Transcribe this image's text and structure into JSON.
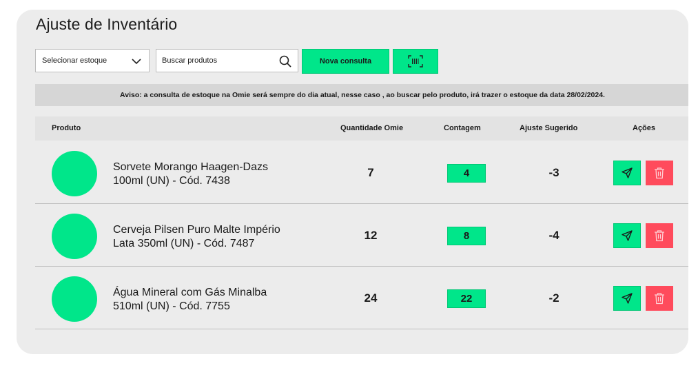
{
  "page": {
    "title": "Ajuste de Inventário"
  },
  "toolbar": {
    "stock_select_value": "Selecionar estoque",
    "search_placeholder": "Buscar produtos",
    "new_query_label": "Nova consulta"
  },
  "notice": {
    "text": "Aviso: a consulta de estoque na Omie será sempre do dia atual, nesse caso , ao buscar pelo produto, irá trazer o estoque da data 28/02/2024."
  },
  "table": {
    "headers": {
      "product": "Produto",
      "qty_omie": "Quantidade Omie",
      "count": "Contagem",
      "suggested": "Ajuste Sugerido",
      "actions": "Ações"
    },
    "rows": [
      {
        "name_line1": "Sorvete Morango Haagen-Dazs",
        "name_line2": "100ml (UN) - Cód. 7438",
        "qty_omie": "7",
        "count": "4",
        "suggested": "-3"
      },
      {
        "name_line1": "Cerveja Pilsen Puro Malte Império",
        "name_line2": "Lata 350ml (UN) - Cód. 7487",
        "qty_omie": "12",
        "count": "8",
        "suggested": "-4"
      },
      {
        "name_line1": "Água Mineral com Gás Minalba",
        "name_line2": "510ml (UN) - Cód. 7755",
        "qty_omie": "24",
        "count": "22",
        "suggested": "-2"
      }
    ]
  },
  "icons": {
    "select": "chevron-down-icon",
    "search": "search-icon",
    "scan": "barcode-scan-icon",
    "send": "send-icon",
    "delete": "trash-icon"
  },
  "colors": {
    "accent": "#00e68a",
    "danger": "#ff4b5c",
    "card_bg": "#ececec",
    "notice_bg": "#d6d6d6"
  }
}
